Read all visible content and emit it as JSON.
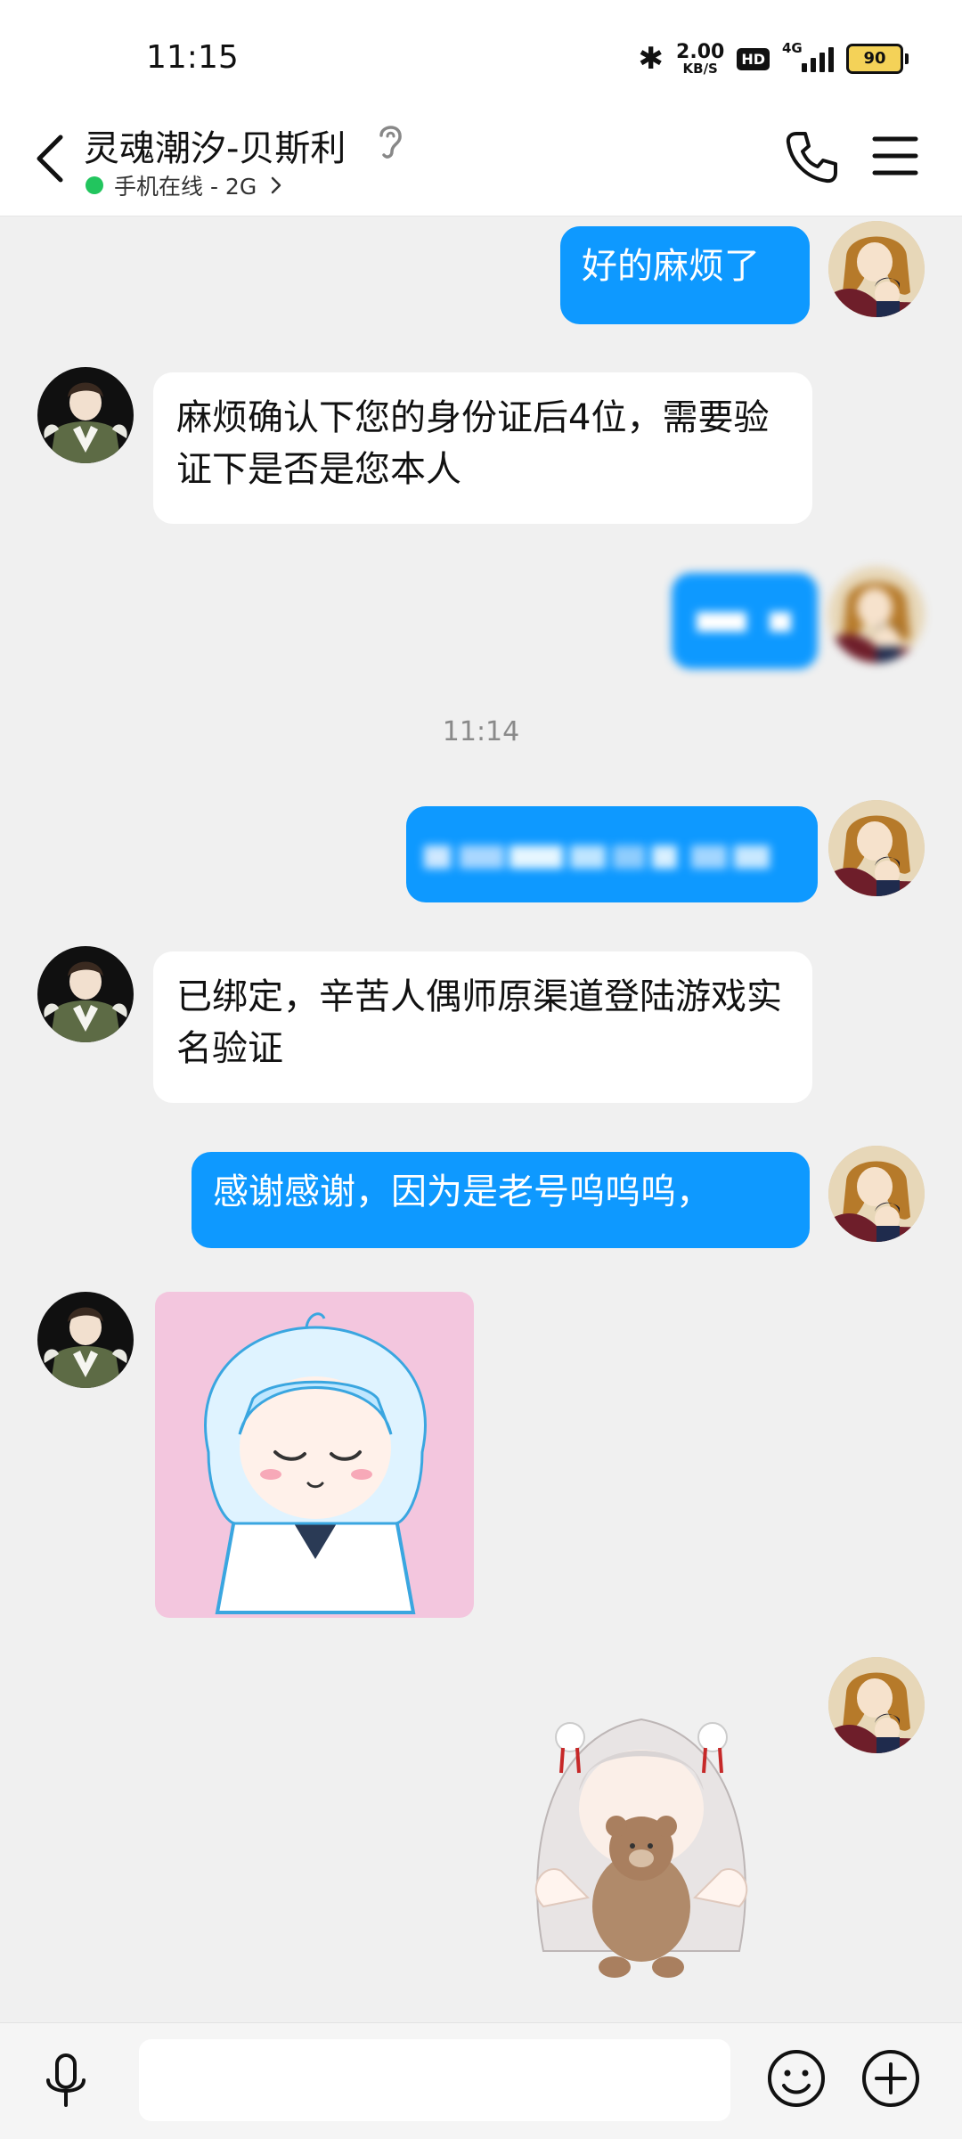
{
  "status_bar": {
    "time": "11:15",
    "net_speed_value": "2.00",
    "net_speed_unit": "KB/S",
    "hd_label": "HD",
    "network_label": "4G",
    "battery": "90"
  },
  "header": {
    "title": "灵魂潮汐-贝斯利",
    "presence": "手机在线 - 2G"
  },
  "messages": [
    {
      "text": "好的麻烦了"
    },
    {
      "text": "麻烦确认下您的身份证后4位，需要验证下是否是您本人"
    },
    {
      "text": ""
    },
    {
      "text": ""
    },
    {
      "text": "已绑定，辛苦人偶师原渠道登陆游戏实名验证"
    },
    {
      "text": "感谢感谢，因为是老号呜呜呜，"
    }
  ],
  "timestamp": "11:14",
  "input": {
    "placeholder": ""
  },
  "colors": {
    "outgoing_bubble": "#0e99ff",
    "incoming_bubble": "#ffffff",
    "background": "#f0f0f0",
    "online_dot": "#22c55e"
  }
}
